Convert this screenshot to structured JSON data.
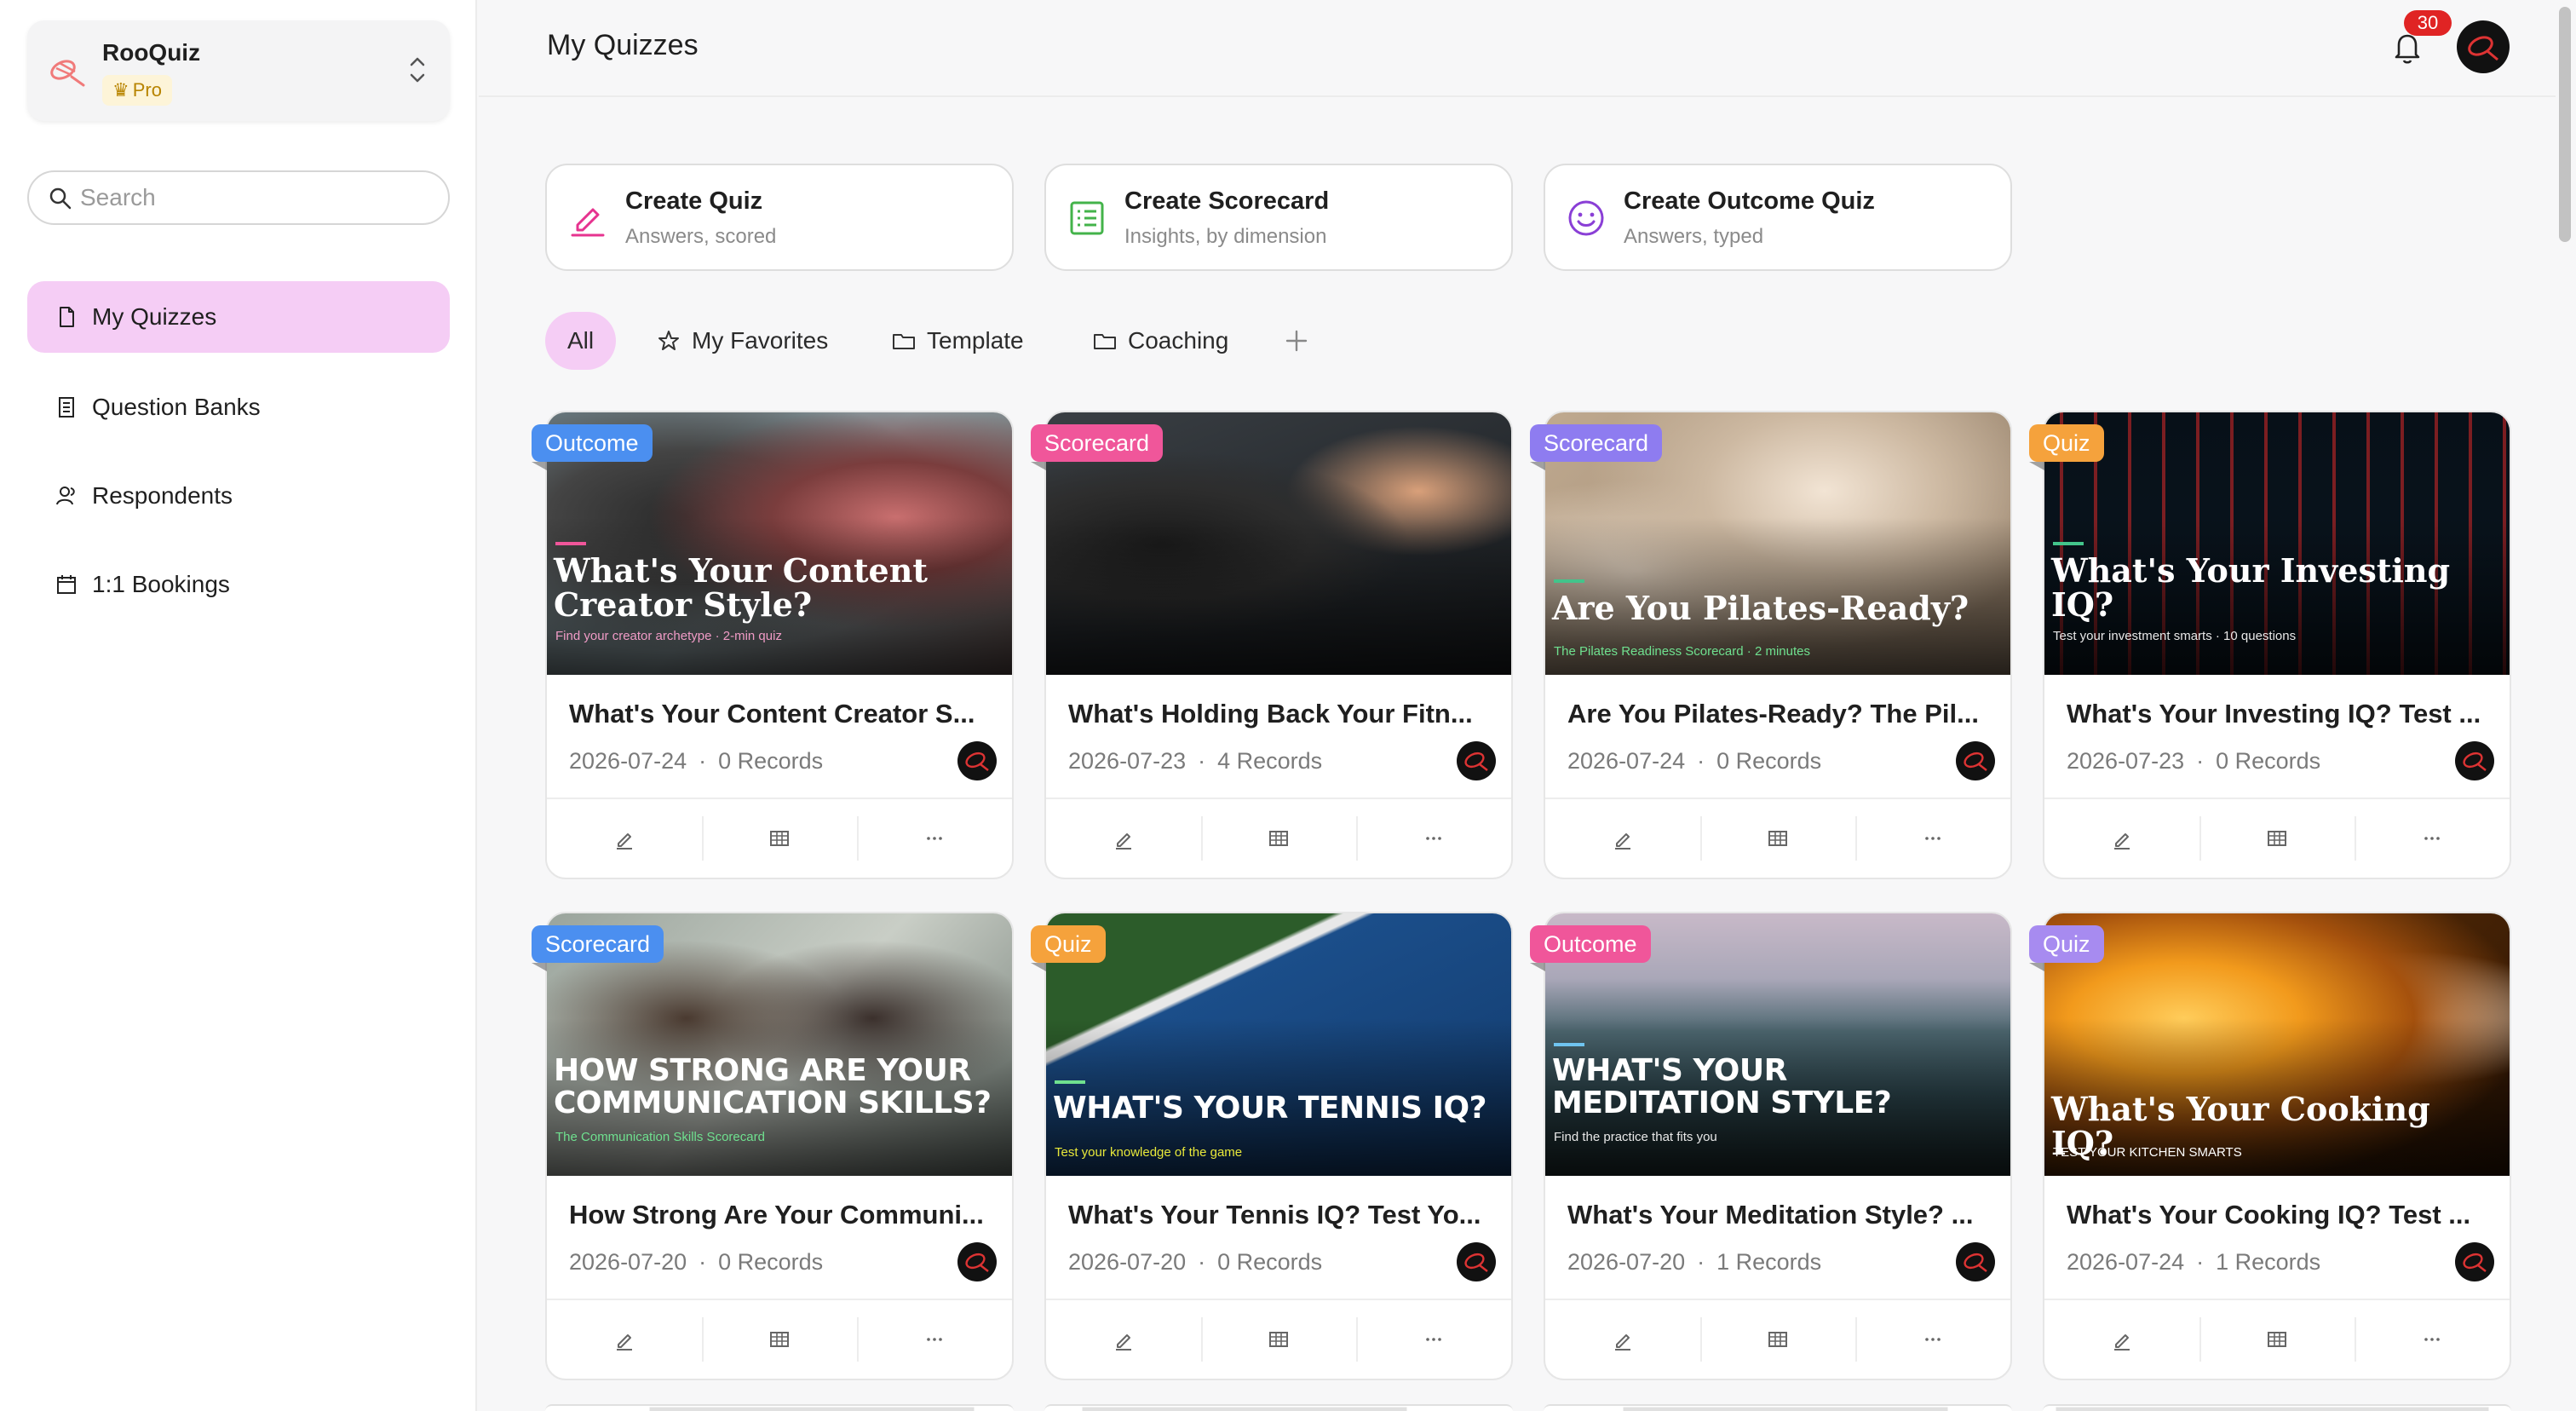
{
  "workspace": {
    "name": "RooQuiz",
    "plan": "Pro"
  },
  "search": {
    "placeholder": "Search"
  },
  "sidebar": {
    "items": [
      {
        "label": "My Quizzes",
        "icon": "file-icon",
        "active": true
      },
      {
        "label": "Question Banks",
        "icon": "book-icon",
        "active": false
      },
      {
        "label": "Respondents",
        "icon": "users-icon",
        "active": false
      },
      {
        "label": "1:1 Bookings",
        "icon": "calendar-icon",
        "active": false
      }
    ]
  },
  "header": {
    "title": "My Quizzes",
    "notifications": "30"
  },
  "create": [
    {
      "title": "Create Quiz",
      "subtitle": "Answers, scored",
      "icon": "pencil-icon",
      "color": "#e6338f"
    },
    {
      "title": "Create Scorecard",
      "subtitle": "Insights, by dimension",
      "icon": "scorecard-icon",
      "color": "#43b34a"
    },
    {
      "title": "Create Outcome Quiz",
      "subtitle": "Answers, typed",
      "icon": "smiley-icon",
      "color": "#8a3fd6"
    }
  ],
  "tabs": [
    {
      "label": "All",
      "icon": "",
      "active": true
    },
    {
      "label": "My Favorites",
      "icon": "star-icon",
      "active": false
    },
    {
      "label": "Template",
      "icon": "folder-icon",
      "active": false
    },
    {
      "label": "Coaching",
      "icon": "folder-icon",
      "active": false
    }
  ],
  "colors": {
    "outcome": "#f0569a",
    "scorecard": "#8e7cf0",
    "quiz": "#f5a23c",
    "scorecard_blue": "#4b8ff0",
    "accent_pink": "#f5cdf5"
  },
  "quizzes": [
    {
      "type": "Outcome",
      "badge_color": "#4b8ff0",
      "cover_title": "What's Your Content Creator Style?",
      "cover_sub": "Find your creator archetype · 2-min quiz",
      "title": "What's Your Content Creator S...",
      "date": "2026-07-24",
      "records": "0 Records"
    },
    {
      "type": "Scorecard",
      "badge_color": "#f0569a",
      "cover_title": "",
      "cover_sub": "",
      "title": "What's Holding Back Your Fitn...",
      "date": "2026-07-23",
      "records": "4 Records"
    },
    {
      "type": "Scorecard",
      "badge_color": "#8e7cf0",
      "cover_title": "Are You Pilates-Ready?",
      "cover_sub": "The Pilates Readiness Scorecard · 2 minutes",
      "title": "Are You Pilates-Ready? The Pil...",
      "date": "2026-07-24",
      "records": "0 Records"
    },
    {
      "type": "Quiz",
      "badge_color": "#f5a23c",
      "cover_title": "What's Your Investing IQ?",
      "cover_sub": "Test your investment smarts · 10 questions",
      "title": "What's Your Investing IQ? Test ...",
      "date": "2026-07-23",
      "records": "0 Records"
    },
    {
      "type": "Scorecard",
      "badge_color": "#4b8ff0",
      "cover_title": "HOW STRONG ARE YOUR COMMUNICATION SKILLS?",
      "cover_sub": "The Communication Skills Scorecard",
      "title": "How Strong Are Your Communi...",
      "date": "2026-07-20",
      "records": "0 Records"
    },
    {
      "type": "Quiz",
      "badge_color": "#f5a23c",
      "cover_title": "WHAT'S YOUR TENNIS IQ?",
      "cover_sub": "Test your knowledge of the game",
      "title": "What's Your Tennis IQ? Test Yo...",
      "date": "2026-07-20",
      "records": "0 Records"
    },
    {
      "type": "Outcome",
      "badge_color": "#f0569a",
      "cover_title": "WHAT'S YOUR MEDITATION STYLE?",
      "cover_sub": "Find the practice that fits you",
      "title": "What's Your Meditation Style? ...",
      "date": "2026-07-20",
      "records": "1 Records"
    },
    {
      "type": "Quiz",
      "badge_color": "#a78bf0",
      "cover_title": "What's Your Cooking IQ?",
      "cover_sub": "TEST YOUR KITCHEN SMARTS",
      "title": "What's Your Cooking IQ? Test ...",
      "date": "2026-07-24",
      "records": "1 Records"
    }
  ]
}
